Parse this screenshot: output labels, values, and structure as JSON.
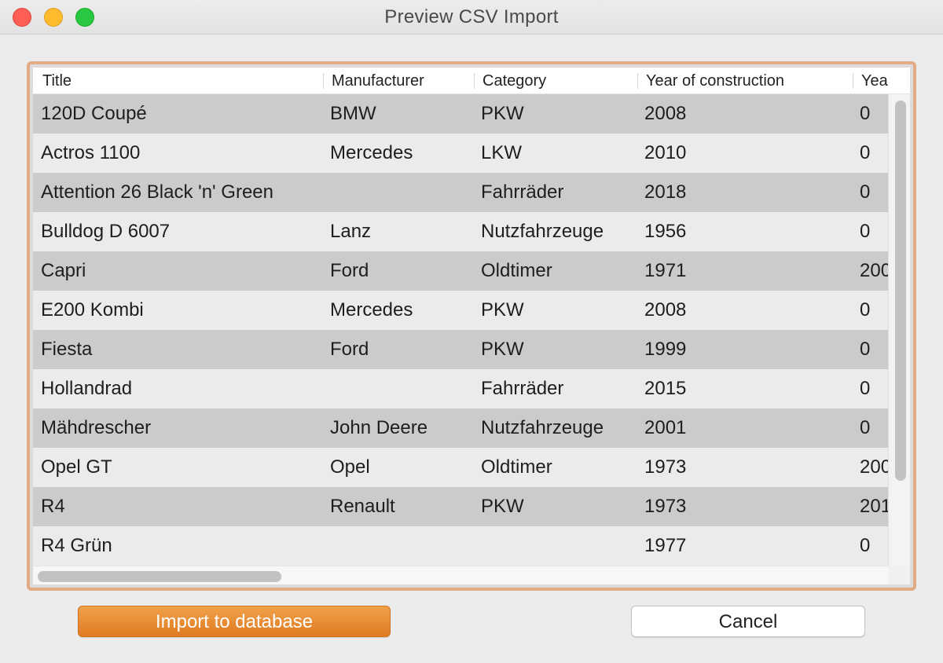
{
  "window": {
    "title": "Preview CSV Import",
    "buttons": [
      "close",
      "minimize",
      "zoom"
    ]
  },
  "table": {
    "columns": [
      "Title",
      "Manufacturer",
      "Category",
      "Year of construction",
      "Yea"
    ],
    "rows": [
      [
        "120D Coupé",
        "BMW",
        "PKW",
        "2008",
        "0"
      ],
      [
        "Actros 1100",
        "Mercedes",
        "LKW",
        "2010",
        "0"
      ],
      [
        "Attention 26 Black 'n' Green",
        "",
        "Fahrräder",
        "2018",
        "0"
      ],
      [
        "Bulldog D 6007",
        "Lanz",
        "Nutzfahrzeuge",
        "1956",
        "0"
      ],
      [
        "Capri",
        "Ford",
        "Oldtimer",
        "1971",
        "200"
      ],
      [
        "E200 Kombi",
        "Mercedes",
        "PKW",
        "2008",
        "0"
      ],
      [
        "Fiesta",
        "Ford",
        "PKW",
        "1999",
        "0"
      ],
      [
        "Hollandrad",
        "",
        "Fahrräder",
        "2015",
        "0"
      ],
      [
        "Mähdrescher",
        "John Deere",
        "Nutzfahrzeuge",
        "2001",
        "0"
      ],
      [
        "Opel GT",
        "Opel",
        "Oldtimer",
        "1973",
        "200"
      ],
      [
        "R4",
        "Renault",
        "PKW",
        "1973",
        "201"
      ],
      [
        "R4 Grün",
        "",
        "",
        "1977",
        "0"
      ]
    ]
  },
  "actions": {
    "import_label": "Import to database",
    "cancel_label": "Cancel"
  },
  "colors": {
    "accent": "#e2aa85",
    "primary_button": "#e8862f",
    "row_odd": "#cbcbcb",
    "row_even": "#ebebeb"
  }
}
